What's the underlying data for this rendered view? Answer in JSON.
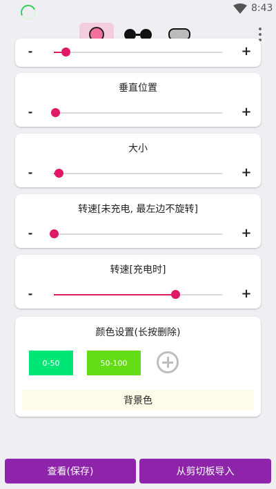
{
  "status_bar": {
    "time": "8:43",
    "wifi_icon": "wifi-icon",
    "loading_icon": "loading-spinner-icon"
  },
  "toolbar": {
    "icons": [
      "circle-shape-icon",
      "dual-circle-shape-icon",
      "pill-shape-icon",
      "more-vert-icon"
    ],
    "selected": "circle-shape-icon"
  },
  "cards": [
    {
      "title": "",
      "minus": "-",
      "plus": "+",
      "value": 0.07
    },
    {
      "title": "垂直位置",
      "minus": "-",
      "plus": "+",
      "value": 0.01
    },
    {
      "title": "大小",
      "minus": "-",
      "plus": "+",
      "value": 0.03
    },
    {
      "title": "转速[未充电, 最左边不旋转]",
      "minus": "-",
      "plus": "+",
      "value": 0.0
    },
    {
      "title": "转速[充电时]",
      "minus": "-",
      "plus": "+",
      "value": 0.72
    }
  ],
  "color_settings": {
    "title": "颜色设置(长按删除)",
    "swatches": [
      {
        "label": "0-50",
        "color": "#00e676"
      },
      {
        "label": "50-100",
        "color": "#64dd17"
      }
    ],
    "add_icon": "add-circle-icon",
    "background_label": "背景色"
  },
  "buttons": {
    "view_save": "查看(保存)",
    "import_clipboard": "从剪切板导入"
  },
  "colors": {
    "accent": "#8e24aa",
    "slider": "#e01865"
  }
}
